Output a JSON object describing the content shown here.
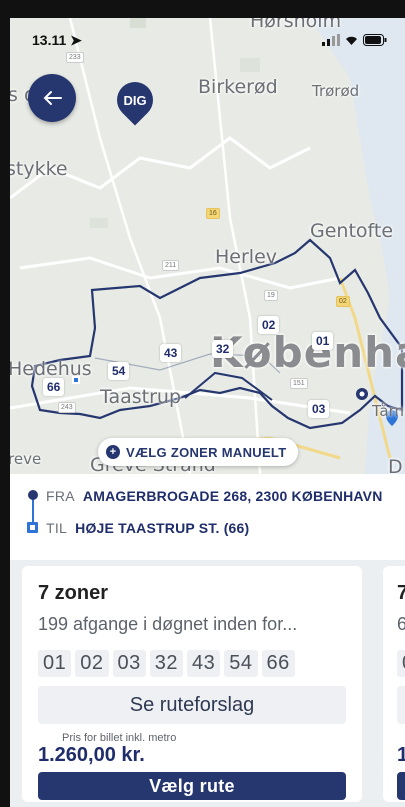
{
  "status_bar": {
    "time": "13.11"
  },
  "map": {
    "places": {
      "horsholm": "Hørsholm",
      "birkerod": "Birkerød",
      "trorod": "Trørød",
      "stykke": "stykke",
      "s_d": "s   d",
      "gentofte": "Gentofte",
      "herlev": "Herlev",
      "kobenhavn": "Københa",
      "hedehus": "Hedehus",
      "taastrup": "Taastrup",
      "greve": "Greve Strand",
      "reve": "reve",
      "tarnby": "Tårn",
      "d_right": "D"
    },
    "pin_label": "DIG",
    "zones": [
      "02",
      "01",
      "43",
      "32",
      "54",
      "66",
      "03"
    ],
    "roads": [
      "233",
      "16",
      "211",
      "19",
      "243",
      "151",
      "02"
    ],
    "manual_zones_label": "VÆLG ZONER MANUELT"
  },
  "route": {
    "from_label": "FRA",
    "from_value": "AMAGERBROGADE 268, 2300 KØBENHAVN",
    "to_label": "TIL",
    "to_value": "HØJE TAASTRUP ST. (66)"
  },
  "cards": [
    {
      "title": "7 zoner",
      "subtitle": "199 afgange i døgnet inden for...",
      "zones": [
        "01",
        "02",
        "03",
        "32",
        "43",
        "54",
        "66"
      ],
      "route_button": "Se ruteforslag",
      "price_label": "Pris for billet inkl. metro",
      "price": "1.260,00 kr.",
      "select_button": "Vælg rute"
    },
    {
      "title": "7",
      "subtitle": "6",
      "zone_first": "0",
      "price": "1"
    }
  ]
}
